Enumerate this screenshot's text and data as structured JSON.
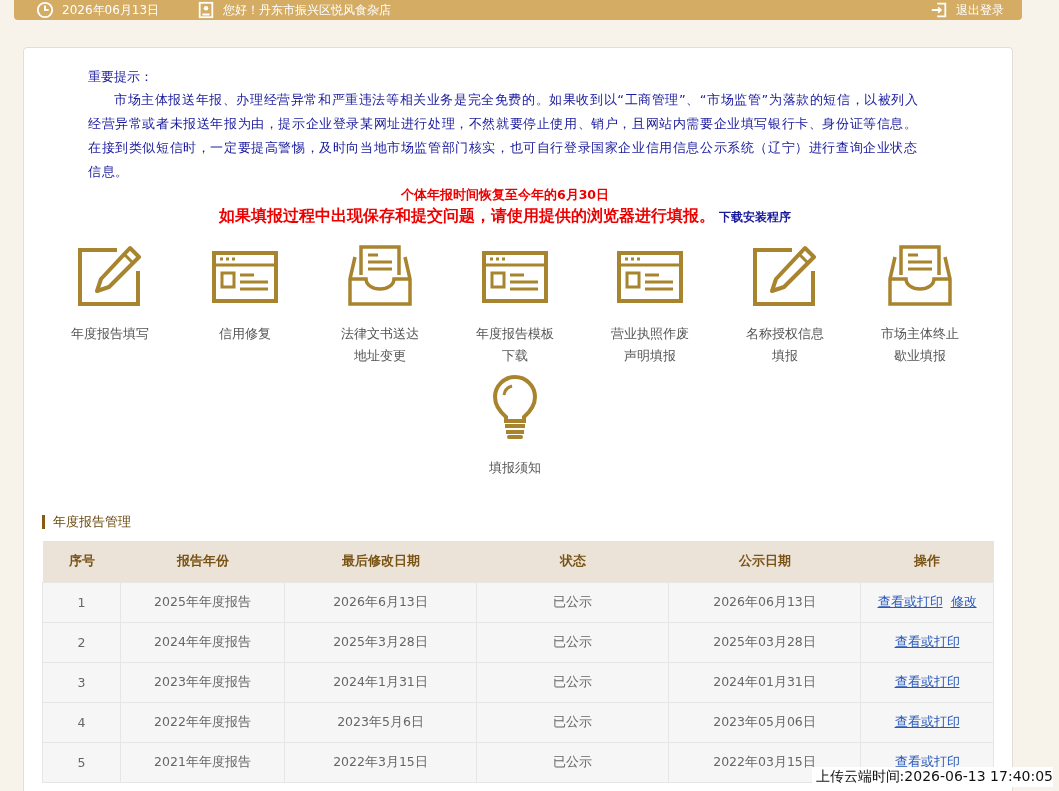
{
  "top_bar": {
    "date": "2026年06月13日",
    "greeting": "您好！丹东市振兴区悦风食杂店",
    "logout": "退出登录"
  },
  "notice": {
    "title": "重要提示：",
    "body": "市场主体报送年报、办理经营异常和严重违法等相关业务是完全免费的。如果收到以“工商管理”、“市场监管”为落款的短信，以被列入经营异常或者未报送年报为由，提示企业登录某网址进行处理，不然就要停止使用、销户，且网站内需要企业填写银行卡、身份证等信息。在接到类似短信时，一定要提高警惕，及时向当地市场监管部门核实，也可自行登录国家企业信用信息公示系统（辽宁）进行查询企业状态信息。",
    "deadline": "个体年报时间恢复至今年的6月30日",
    "warning": "如果填报过程中出现保存和提交问题，请使用提供的浏览器进行填报。",
    "download_link": "下载安装程序"
  },
  "services": [
    {
      "kind": "pencil",
      "label": [
        "年度报告填写"
      ]
    },
    {
      "kind": "window",
      "label": [
        "信用修复"
      ]
    },
    {
      "kind": "tray",
      "label": [
        "法律文书送达",
        "地址变更"
      ]
    },
    {
      "kind": "window",
      "label": [
        "年度报告模板",
        "下载"
      ]
    },
    {
      "kind": "window",
      "label": [
        "营业执照作废",
        "声明填报"
      ]
    },
    {
      "kind": "pencil",
      "label": [
        "名称授权信息",
        "填报"
      ]
    },
    {
      "kind": "tray",
      "label": [
        "市场主体终止",
        "歇业填报"
      ]
    },
    {
      "kind": "bulb",
      "label": [
        "填报须知"
      ]
    }
  ],
  "table": {
    "title": "年度报告管理",
    "columns": [
      "序号",
      "报告年份",
      "最后修改日期",
      "状态",
      "公示日期",
      "操作"
    ],
    "rows": [
      {
        "cells": [
          "1",
          "2025年年度报告",
          "2026年6月13日",
          "已公示",
          "2026年06月13日"
        ],
        "actions": [
          "查看或打印",
          "修改"
        ]
      },
      {
        "cells": [
          "2",
          "2024年年度报告",
          "2025年3月28日",
          "已公示",
          "2025年03月28日"
        ],
        "actions": [
          "查看或打印"
        ]
      },
      {
        "cells": [
          "3",
          "2023年年度报告",
          "2024年1月31日",
          "已公示",
          "2024年01月31日"
        ],
        "actions": [
          "查看或打印"
        ]
      },
      {
        "cells": [
          "4",
          "2022年年度报告",
          "2023年5月6日",
          "已公示",
          "2023年05月06日"
        ],
        "actions": [
          "查看或打印"
        ]
      },
      {
        "cells": [
          "5",
          "2021年年度报告",
          "2022年3月15日",
          "已公示",
          "2022年03月15日"
        ],
        "actions": [
          "查看或打印"
        ]
      }
    ]
  },
  "upload_stamp": "上传云端时间:2026-06-13 17:40:05"
}
